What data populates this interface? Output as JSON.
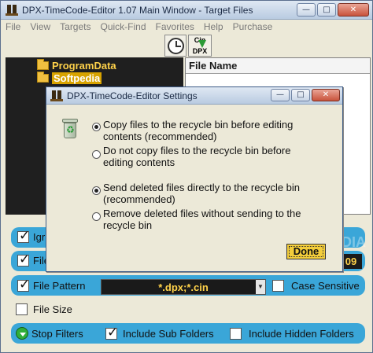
{
  "window": {
    "title": "DPX-TimeCode-Editor 1.07 Main Window - Target Files",
    "controls": {
      "minimize": "—",
      "maximize": "□",
      "close": "✕"
    }
  },
  "menu": [
    "File",
    "View",
    "Targets",
    "Quick-Find",
    "Favorites",
    "Help",
    "Purchase"
  ],
  "toolbar": {
    "cin_line1": "Cin",
    "cin_line2": "DPX"
  },
  "tree": {
    "items": [
      "ProgramData",
      "Softpedia"
    ]
  },
  "filelist": {
    "header": "File Name"
  },
  "filters": {
    "row1_label": "Igr",
    "row2_label": "File",
    "row2_value": "09",
    "pattern_label": "File Pattern",
    "pattern_value": "*.dpx;*.cin",
    "case_sensitive_label": "Case Sensitive",
    "file_size_label": "File Size",
    "stop_filters_label": "Stop Filters",
    "include_sub_label": "Include Sub Folders",
    "include_hidden_label": "Include Hidden Folders"
  },
  "watermark": "SOFTPEDIA",
  "dialog": {
    "title": "DPX-TimeCode-Editor Settings",
    "options": [
      "Copy files to the recycle bin before editing contents (recommended)",
      "Do not copy files to the recycle bin before editing contents",
      "Send deleted files directly to the recycle bin (recommended)",
      "Remove deleted files without sending to the recycle bin"
    ],
    "done_label": "Done"
  },
  "colors": {
    "accent_bar": "#3aa6d8",
    "tree_bg": "#1f1f1f",
    "folder_text": "#ffd24a",
    "done_button": "#f3cd3b"
  }
}
